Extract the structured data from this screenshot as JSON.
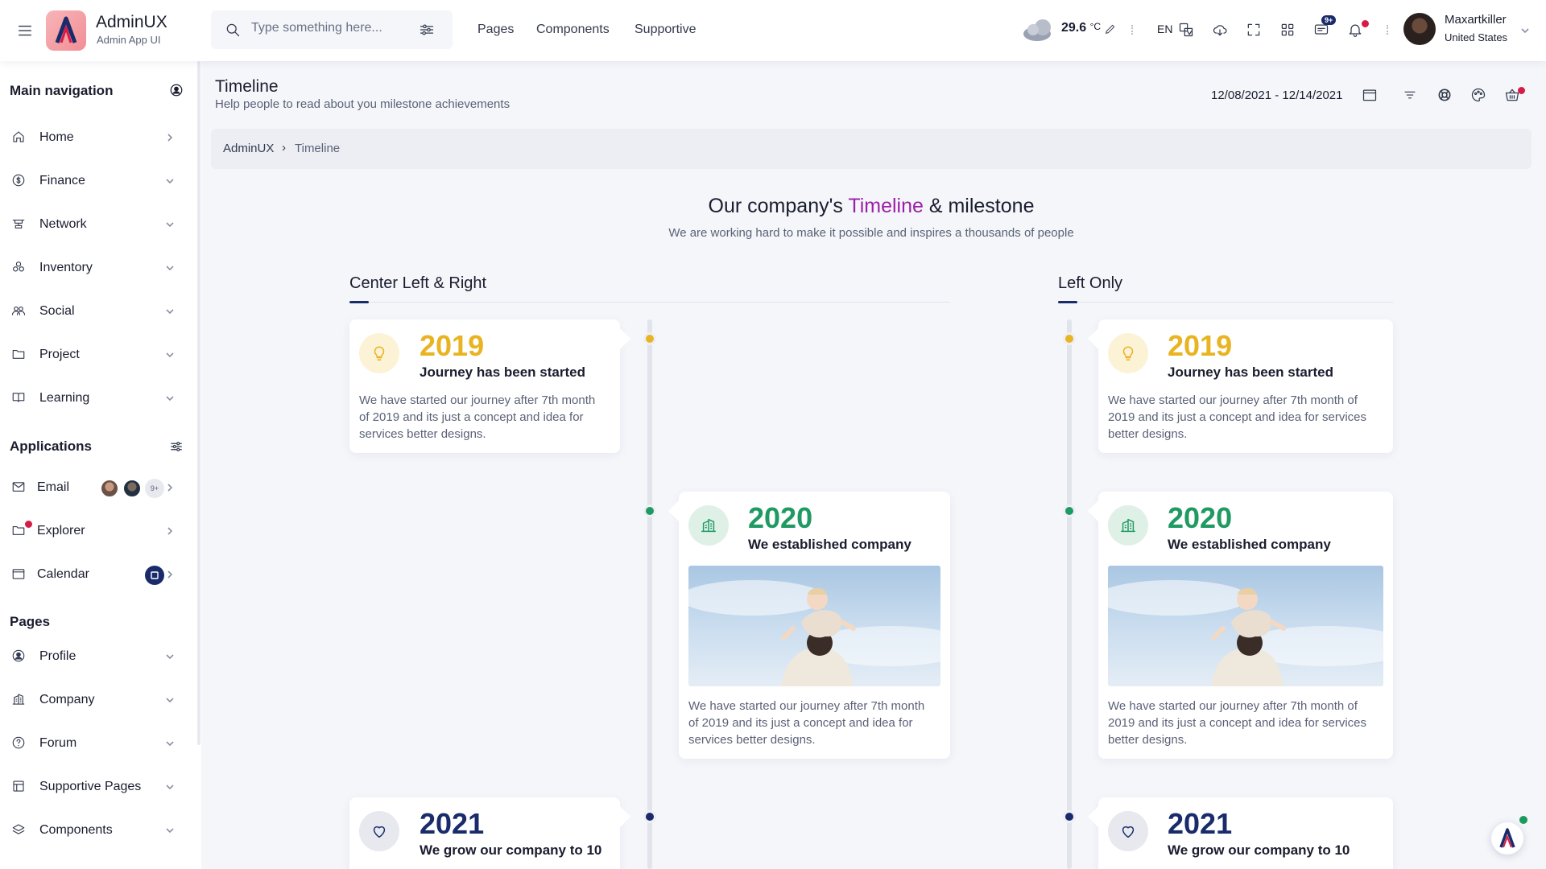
{
  "header": {
    "brand_name": "AdminUX",
    "brand_sub": "Admin App UI",
    "search_placeholder": "Type something here...",
    "nav": [
      "Pages",
      "Components",
      "Supportive"
    ],
    "weather_temp": "29.6",
    "weather_unit": "°C",
    "language": "EN",
    "messages_badge": "9+",
    "user_name": "Maxartkiller",
    "user_location": "United States"
  },
  "sidebar": {
    "main_title": "Main navigation",
    "main_items": [
      {
        "label": "Home",
        "icon": "home-icon"
      },
      {
        "label": "Finance",
        "icon": "dollar-icon"
      },
      {
        "label": "Network",
        "icon": "network-icon"
      },
      {
        "label": "Inventory",
        "icon": "boxes-icon"
      },
      {
        "label": "Social",
        "icon": "people-icon"
      },
      {
        "label": "Project",
        "icon": "folder-icon"
      },
      {
        "label": "Learning",
        "icon": "book-icon"
      }
    ],
    "apps_title": "Applications",
    "app_items": [
      {
        "label": "Email",
        "icon": "mail-icon",
        "badge": "9+"
      },
      {
        "label": "Explorer",
        "icon": "folder-icon"
      },
      {
        "label": "Calendar",
        "icon": "calendar-icon"
      }
    ],
    "pages_title": "Pages",
    "page_items": [
      {
        "label": "Profile",
        "icon": "user-circle-icon"
      },
      {
        "label": "Company",
        "icon": "building-icon"
      },
      {
        "label": "Forum",
        "icon": "question-icon"
      },
      {
        "label": "Supportive Pages",
        "icon": "layers-icon"
      },
      {
        "label": "Components",
        "icon": "stack-icon"
      }
    ]
  },
  "page": {
    "title": "Timeline",
    "subtitle": "Help people to read about you milestone achievements",
    "date_range": "12/08/2021 - 12/14/2021",
    "breadcrumb_root": "AdminUX",
    "breadcrumb_sep": "›",
    "breadcrumb_current": "Timeline"
  },
  "hero": {
    "title_before": "Our company's ",
    "title_accent": "Timeline",
    "title_after": " & milestone",
    "subtitle": "We are working hard to make it possible and inspires a thousands of people"
  },
  "sections": {
    "center": "Center Left & Right",
    "left": "Left Only"
  },
  "milestones": [
    {
      "year": "2019",
      "heading": "Journey has been started",
      "text": "We have started our journey after 7th month of 2019 and its just a concept and idea for services better designs.",
      "color": "#e8b422",
      "icon": "lightbulb-icon"
    },
    {
      "year": "2020",
      "heading": "We established company",
      "text": "We have started our journey after 7th month of 2019 and its just a concept and idea for services better designs.",
      "color": "#1f9a62",
      "icon": "building-icon"
    },
    {
      "year": "2021",
      "heading": "We grow our company to 10",
      "text": "",
      "color": "#1a2b6b",
      "icon": "heart-icon"
    }
  ],
  "colors": {
    "accent_purple": "#9c1fa8",
    "navy": "#1a2b6b",
    "alert_red": "#d81b46",
    "online_green": "#1a9a5c"
  }
}
